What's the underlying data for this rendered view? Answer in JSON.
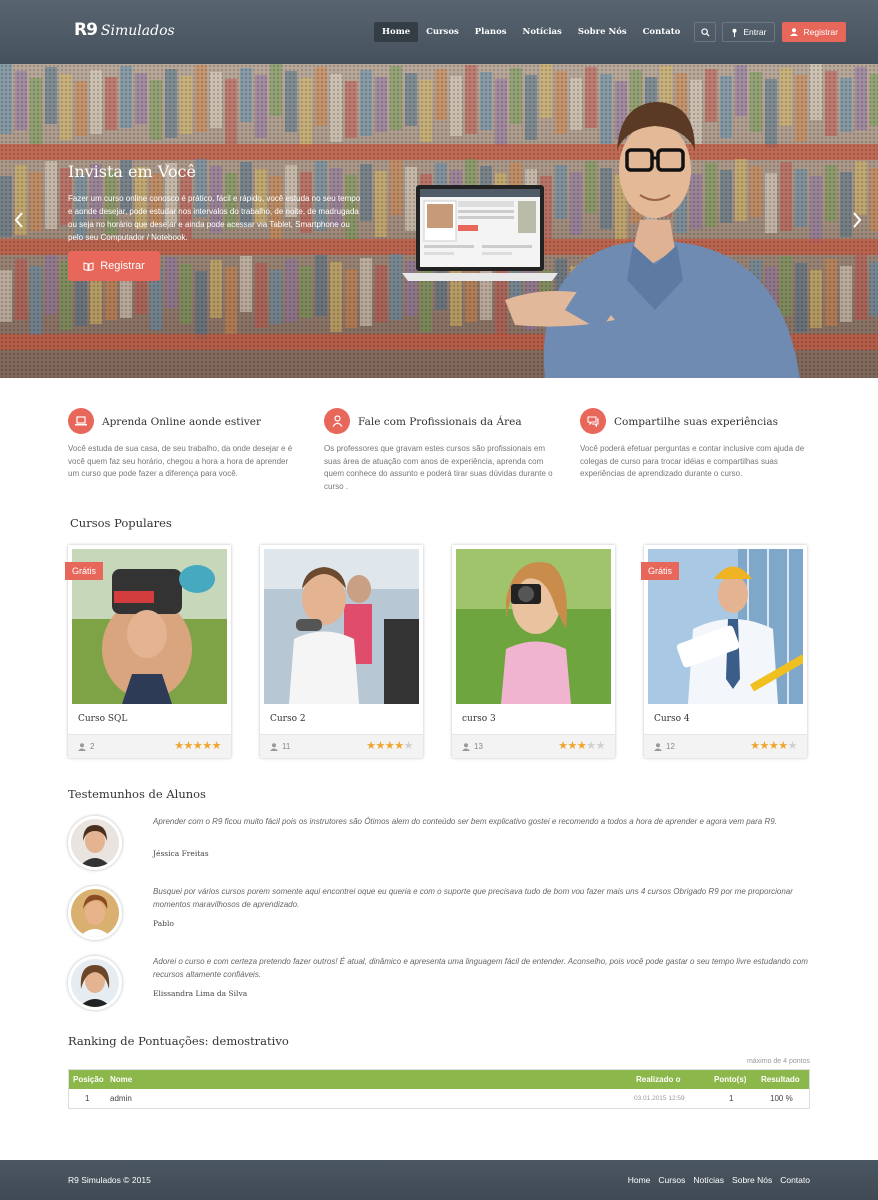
{
  "header": {
    "logo_mark": "R9",
    "logo_text": "Simulados",
    "nav": [
      "Home",
      "Cursos",
      "Planos",
      "Notícias",
      "Sobre Nós",
      "Contato"
    ],
    "login_label": "Entrar",
    "register_label": "Registrar"
  },
  "hero": {
    "title": "Invista em Você",
    "text": "Fazer um curso online conosco é prático, fácil e rápido, você estuda no seu tempo e aonde desejar, pode estudar nos intervalos do trabalho, de noite, de madrugada ou seja no horário que desejar e ainda pode acessar via Tablet, Smartphone ou pelo seu Computador / Notebook.",
    "button": "Registrar"
  },
  "features": [
    {
      "title": "Aprenda Online aonde estiver",
      "text": "Você estuda de sua casa, de seu trabalho, da onde desejar e é você quem faz seu horário, chegou a hora a hora de aprender um curso que pode fazer a diferença para você.",
      "icon": "laptop-icon"
    },
    {
      "title": "Fale com Profissionais da Área",
      "text": "Os professores que gravam estes cursos são profissionais em suas área de atuação com anos de experiência, aprenda com quem conhece do assunto e poderá tirar suas dúvidas durante o curso .",
      "icon": "professional-icon"
    },
    {
      "title": "Compartilhe suas experiências",
      "text": "Você poderá efetuar perguntas e contar inclusive com ajuda de colegas de curso para trocar idéias e compartilhas suas experiências de aprendizado durante o curso.",
      "icon": "chat-icon"
    }
  ],
  "courses_title": "Cursos Populares",
  "courses": [
    {
      "title": "Curso SQL",
      "users": "2",
      "rating": 5,
      "badge": "Grátis"
    },
    {
      "title": "Curso 2",
      "users": "11",
      "rating": 4,
      "badge": ""
    },
    {
      "title": "curso 3",
      "users": "13",
      "rating": 3,
      "badge": ""
    },
    {
      "title": "Curso 4",
      "users": "12",
      "rating": 4,
      "badge": "Grátis"
    }
  ],
  "testimonials_title": "Testemunhos de Alunos",
  "testimonials": [
    {
      "text": "Aprender com  o R9 ficou muito  fácil pois  os  instrutores  são Ótimos alem do conteúdo ser  bem explicativo  gostei e recomendo a todos a hora de aprender e agora  vem para  R9.",
      "name": "Jéssica Freitas"
    },
    {
      "text": "Busquei por vários cursos porem somente aqui encontrei oque eu queria e com o suporte que precisava tudo de  bom vou fazer  mais uns 4 cursos Obrigado R9 por me proporcionar  momentos  maravilhosos de aprendizado.",
      "name": "Pablo"
    },
    {
      "text": "Adorei o curso e com certeza pretendo fazer outros! É atual, dinâmico e apresenta uma linguagem fácil de entender. Aconselho, pois você pode gastar o seu tempo livre estudando com recursos altamente confiáveis.",
      "name": "Elissandra Lima da Silva"
    }
  ],
  "ranking": {
    "title": "Ranking de Pontuações: demostrativo",
    "note": "máximo de 4 pontos",
    "columns": [
      "Posição",
      "Nome",
      "Realizado o",
      "Ponto(s)",
      "Resultado"
    ],
    "rows": [
      {
        "position": "1",
        "name": "admin",
        "date": "03.01.2015 12:59",
        "points": "1",
        "result": "100 %"
      }
    ]
  },
  "footer": {
    "copy": "R9 Simulados © 2015",
    "nav": [
      "Home",
      "Cursos",
      "Notícias",
      "Sobre Nós",
      "Contato"
    ]
  },
  "colors": {
    "accent": "#e8675b",
    "header": "#4f5b66",
    "table_head": "#8cb74a",
    "star": "#f0a52c"
  }
}
